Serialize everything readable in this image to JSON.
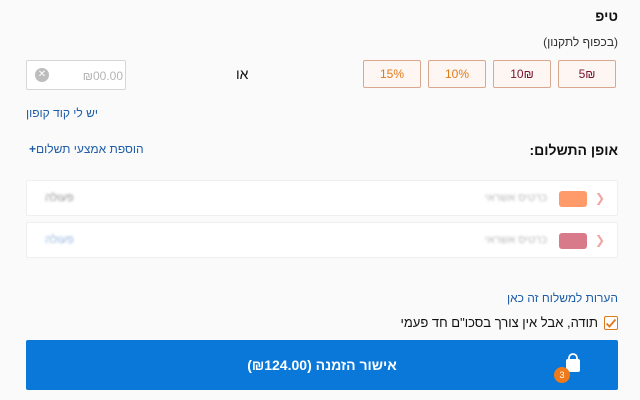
{
  "tip": {
    "title": "טיפ",
    "subtitle": "(בכפוף לתקנון)",
    "options": [
      "5₪",
      "10₪",
      "10%",
      "15%"
    ],
    "or_label": "או",
    "custom_placeholder": "₪00.00",
    "clear_icon": "x-circle-icon",
    "coupon_link": "יש לי קוד קופון"
  },
  "payment": {
    "title": "אופן התשלום:",
    "add_link": "הוספת אמצעי תשלום",
    "add_plus": "+",
    "cards": [
      {
        "description": "כרטיס אשראי",
        "action": "פעולה",
        "logo_color": "#ff9b6b",
        "action_color": "#8d8d8d"
      },
      {
        "description": "כרטיס אשראי",
        "action": "פעולה",
        "logo_color": "#d87a8a",
        "action_color": "#8fb3dc"
      }
    ]
  },
  "notes_link": "הערות למשלוח זה כאן",
  "donation": {
    "label": "תודה, אבל אין צורך בסכו\"ם חד פעמי",
    "checked": true
  },
  "confirm": {
    "label": "אישור הזמנה (₪124.00)",
    "cart_count": "3",
    "icon": "shopping-bag-icon"
  },
  "colors": {
    "accent": "#0a78d8",
    "link": "#1e5ea8",
    "badge": "#f07a1a",
    "maroon": "#7a1232",
    "orange": "#e07a18"
  }
}
